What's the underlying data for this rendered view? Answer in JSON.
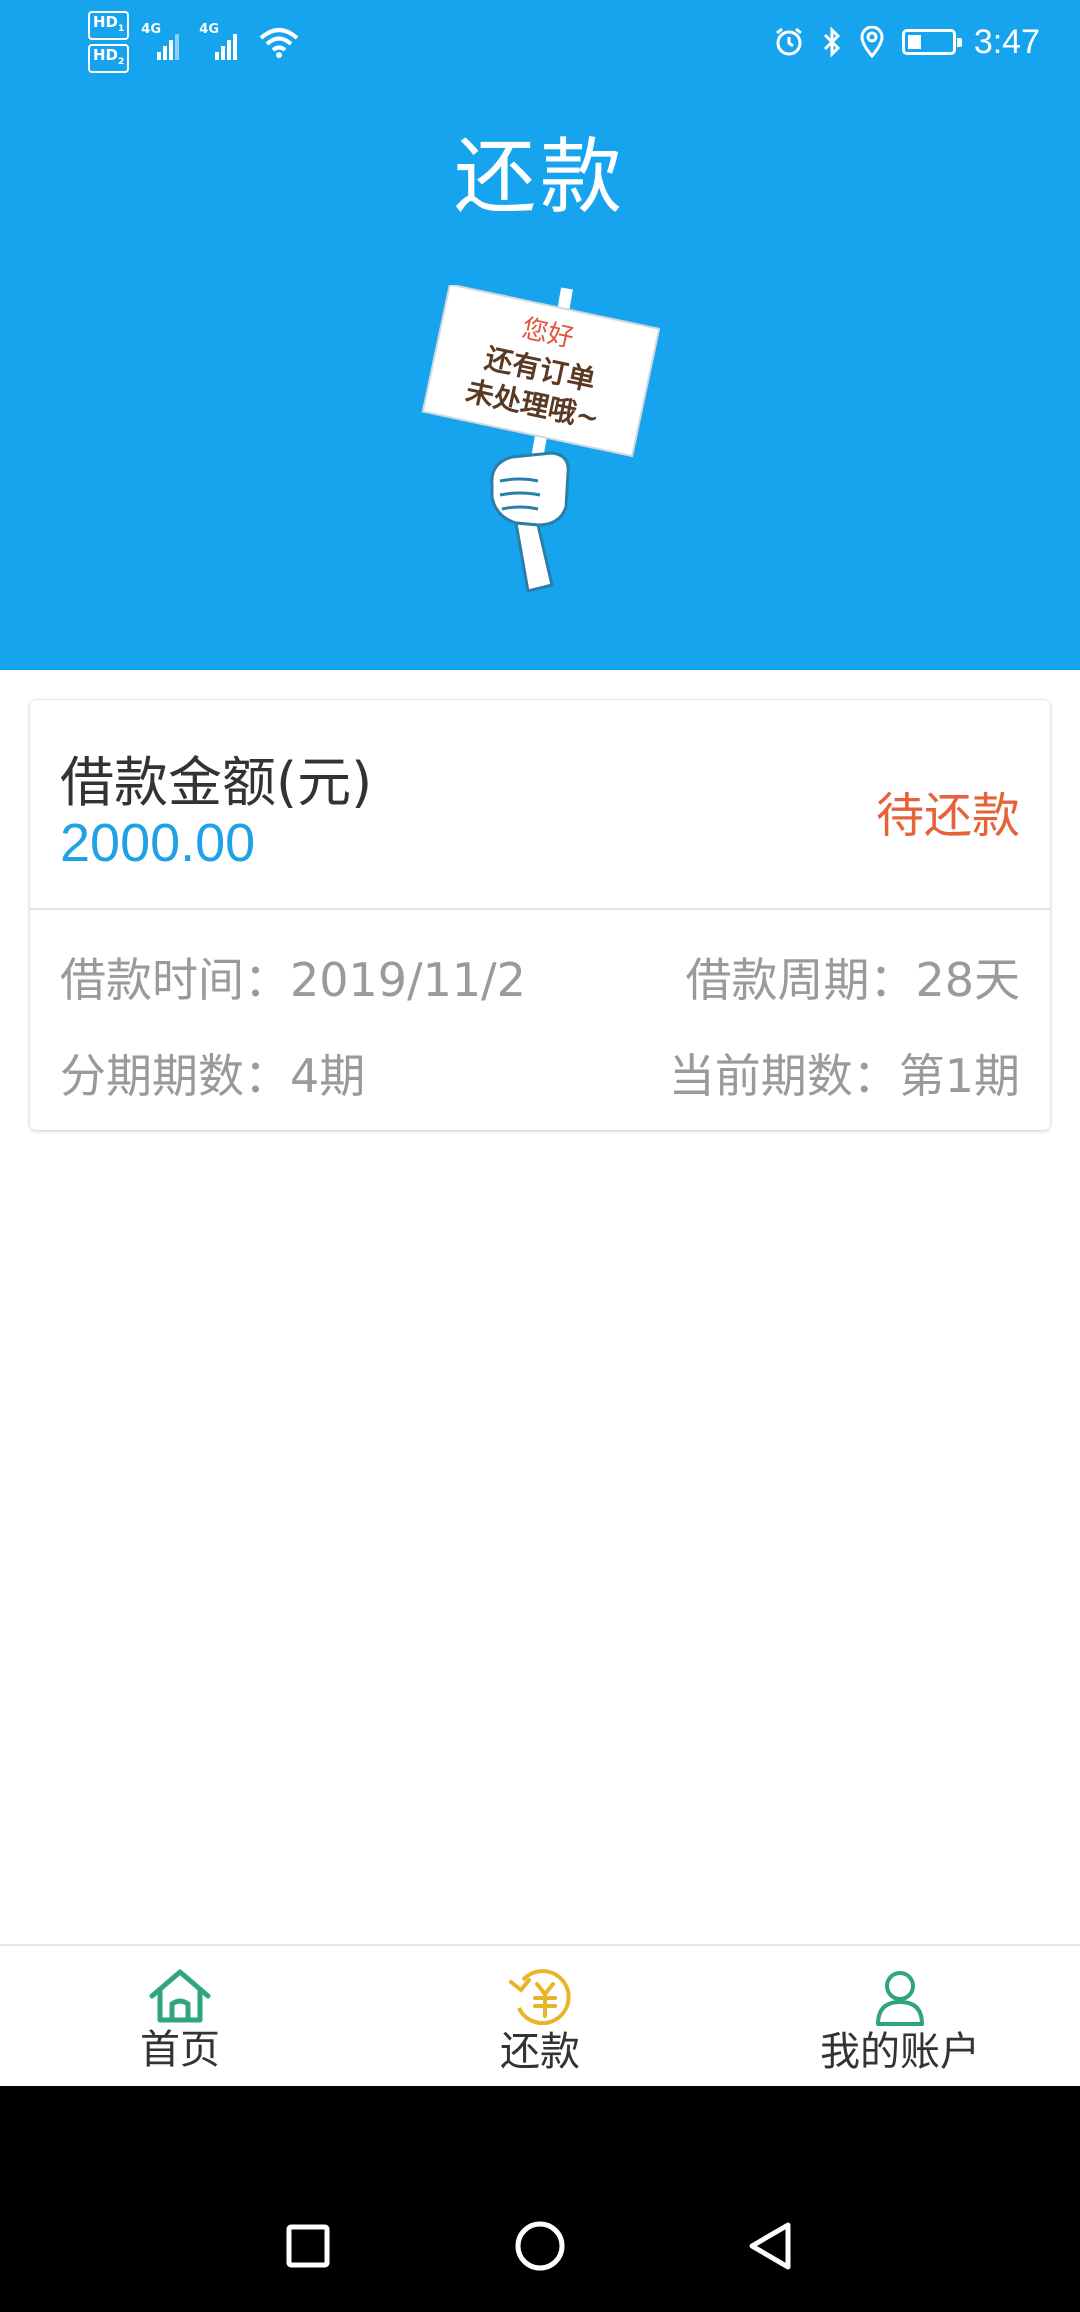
{
  "status_bar": {
    "hd_badges": [
      "HD",
      "HD"
    ],
    "hd_badge_sub": [
      "1",
      "2"
    ],
    "network_tags": [
      "4G",
      "4G"
    ],
    "icons": [
      "alarm-icon",
      "bluetooth-icon",
      "location-icon",
      "battery-icon",
      "wifi-icon"
    ],
    "battery_level": 0.3,
    "time": "3:47"
  },
  "header": {
    "title": "还款",
    "background_color": "#17a4ee",
    "illustration": {
      "sign_lines": [
        "您好",
        "还有订单",
        "未处理哦~"
      ]
    }
  },
  "loan_card": {
    "amount_label": "借款金额(元)",
    "amount_value": "2000.00",
    "status": "待还款",
    "status_color": "#e6633a",
    "details": {
      "loan_time_label": "借款时间：",
      "loan_time_value": "2019/11/2",
      "loan_period_label": "借款周期：",
      "loan_period_value": "28天",
      "installments_label": "分期期数：",
      "installments_value": "4期",
      "current_period_label": "当前期数：",
      "current_period_value": "第1期"
    }
  },
  "bottom_nav": {
    "items": [
      {
        "label": "首页",
        "icon": "home-icon",
        "active": false
      },
      {
        "label": "还款",
        "icon": "repay-yuan-icon",
        "active": true
      },
      {
        "label": "我的账户",
        "icon": "user-icon",
        "active": false
      }
    ],
    "icon_color_green": "#2fa57e",
    "icon_color_gold": "#e8b42a"
  },
  "system_nav": {
    "icons": [
      "recent-apps-icon",
      "home-circle-icon",
      "back-icon"
    ]
  }
}
